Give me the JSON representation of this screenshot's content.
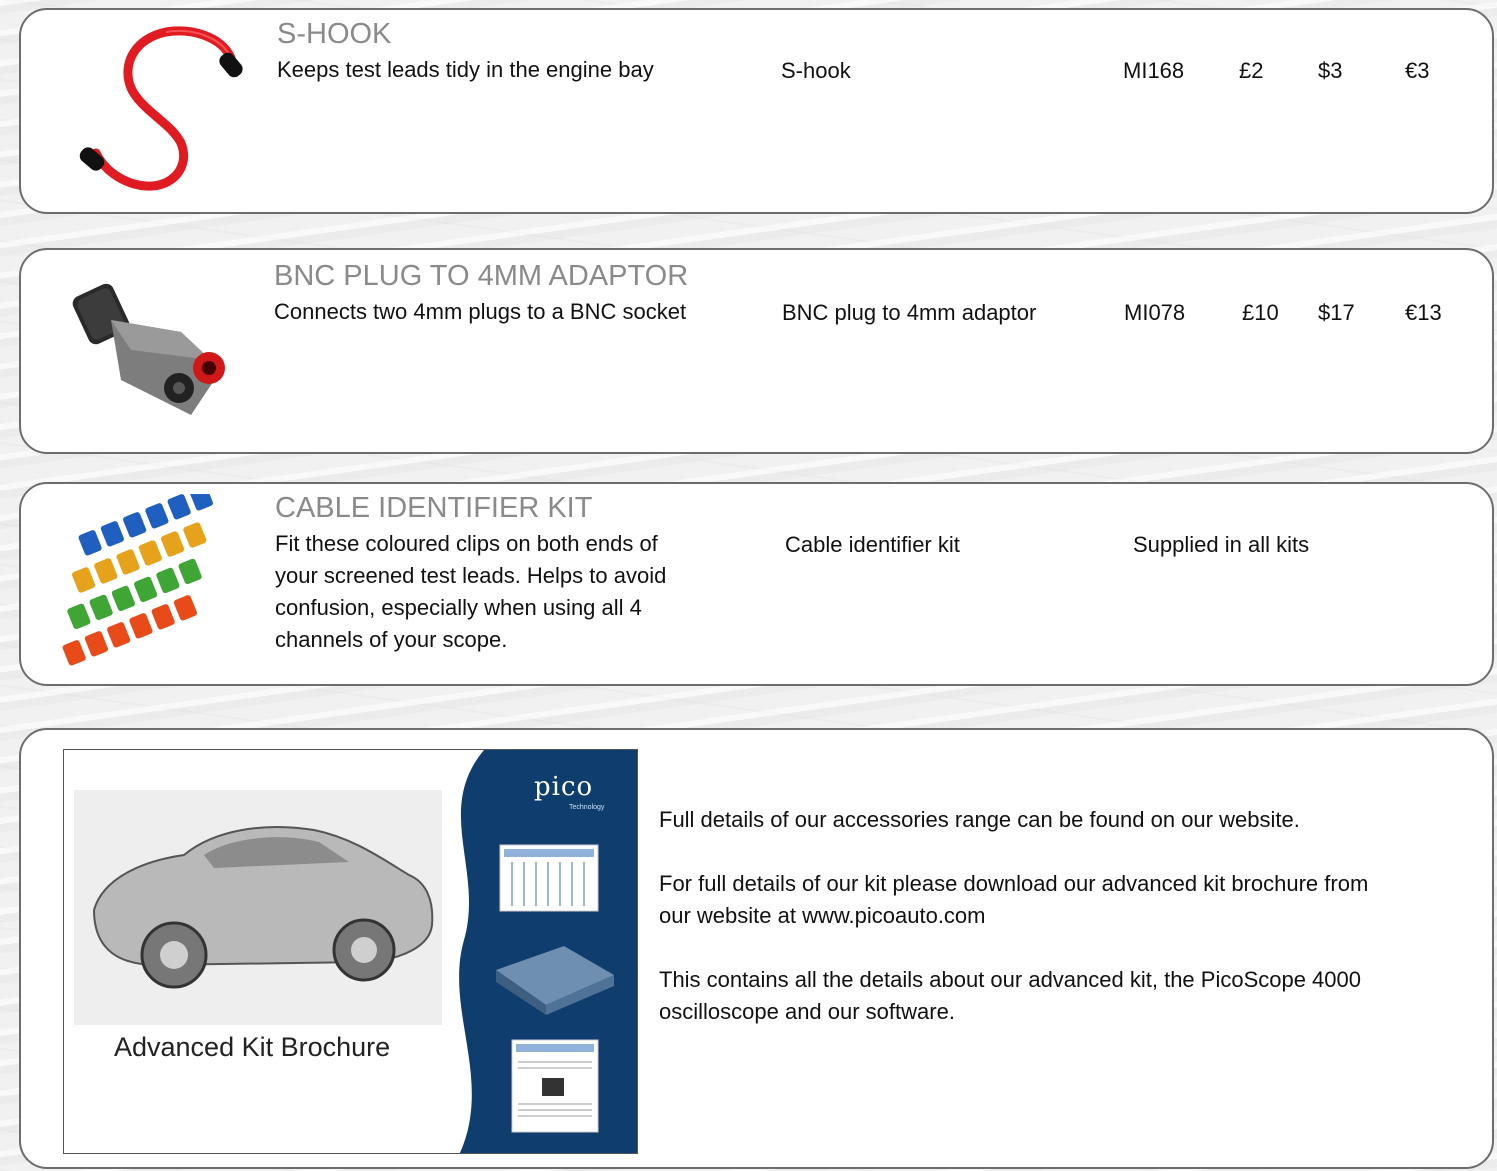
{
  "products": [
    {
      "title": "S-HOOK",
      "description": "Keeps test leads tidy in the engine bay",
      "name": "S-hook",
      "code": "MI168",
      "price_gbp": "£2",
      "price_usd": "$3",
      "price_eur": "€3",
      "image_icon": "s-hook-icon"
    },
    {
      "title": "BNC PLUG TO 4MM ADAPTOR",
      "description": "Connects two 4mm plugs to a BNC socket",
      "name": "BNC plug to 4mm adaptor",
      "code": "MI078",
      "price_gbp": "£10",
      "price_usd": "$17",
      "price_eur": "€13",
      "image_icon": "bnc-adaptor-icon"
    },
    {
      "title": "CABLE IDENTIFIER KIT",
      "description_lines": [
        "Fit these coloured clips on both ends of",
        "your screened test leads. Helps to avoid",
        "confusion, especially when using all 4",
        "channels of your scope."
      ],
      "name": "Cable identifier kit",
      "availability": "Supplied in all kits",
      "image_icon": "cable-clips-icon"
    }
  ],
  "brochure": {
    "label": "Advanced Kit Brochure",
    "logo": "pico",
    "logo_sub": "Technology",
    "paragraphs": [
      "Full details of our accessories range can be found on our website.",
      "For full details of our kit please download our advanced kit brochure from",
      "our website at www.picoauto.com",
      "This contains all the details about our advanced kit, the PicoScope 4000",
      "oscilloscope and our software."
    ]
  },
  "colors": {
    "card_border": "#6d6d6d",
    "title_grey": "#8a8a8a",
    "brochure_blue": "#0f3d6e",
    "hook_red": "#e01b22"
  }
}
